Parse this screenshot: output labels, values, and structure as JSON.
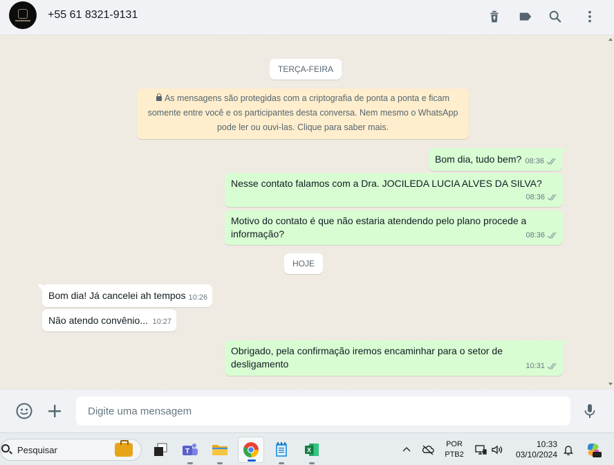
{
  "header": {
    "contact_name": "+55 61 8321-9131",
    "icons": [
      "delete-icon",
      "label-icon",
      "search-icon",
      "menu-icon"
    ]
  },
  "chat": {
    "date_pills": [
      "TERÇA-FEIRA",
      "HOJE"
    ],
    "encryption_notice": {
      "line1": "As mensagens são protegidas com a criptografia de ponta a ponta e ficam",
      "line2": "somente entre você e os participantes desta conversa. Nem mesmo o WhatsApp",
      "line3": "pode ler ou ouvi-las. Clique para saber mais."
    },
    "messages": [
      {
        "direction": "out",
        "lines": [
          "Bom dia, tudo bem?"
        ],
        "time": "08:36",
        "status": "read"
      },
      {
        "direction": "out",
        "lines": [
          "Nesse contato falamos com a Dra. JOCILEDA LUCIA ALVES DA SILVA?"
        ],
        "time": "08:36",
        "status": "read"
      },
      {
        "direction": "out",
        "lines": [
          "Motivo do contato é que não estaria atendendo pelo plano procede a",
          "informação?"
        ],
        "time": "08:36",
        "status": "read"
      },
      {
        "direction": "in",
        "lines": [
          "Bom dia! Já cancelei ah tempos"
        ],
        "time": "10:26"
      },
      {
        "direction": "in",
        "lines": [
          "Não atendo convênio..."
        ],
        "time": "10:27"
      },
      {
        "direction": "out",
        "lines": [
          "Obrigado, pela confirmação iremos encaminhar para o setor de",
          "desligamento"
        ],
        "time": "10:31",
        "status": "read"
      }
    ]
  },
  "composer": {
    "placeholder": "Digite uma mensagem",
    "icons": [
      "emoji-icon",
      "plus-icon",
      "microphone-icon"
    ]
  },
  "taskbar": {
    "search_label": "Pesquisar",
    "apps": [
      "task-view-icon",
      "teams-icon",
      "file-explorer-icon",
      "chrome-icon",
      "notepad-icon",
      "excel-icon"
    ],
    "language": {
      "line1": "POR",
      "line2": "PTB2"
    },
    "clock": {
      "time": "10:33",
      "date": "03/10/2024"
    },
    "colors": {
      "chrome_red": "#ea4335",
      "excel_green": "#107c41",
      "teams_purple": "#5b5fc7",
      "folder_yellow": "#f5c542"
    }
  }
}
